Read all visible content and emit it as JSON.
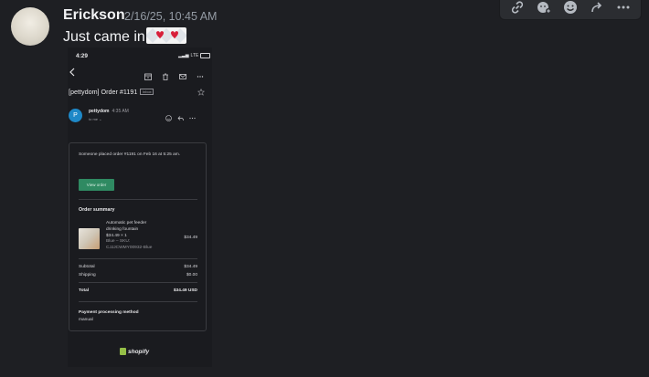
{
  "message": {
    "username": "Erickson",
    "timestamp": "2/16/25, 10:45 AM",
    "text": "Just came in"
  },
  "toolbar": {
    "icons": [
      "link-icon",
      "reaction-icon",
      "emoji-icon",
      "forward-icon",
      "more-icon"
    ]
  },
  "screenshot": {
    "status_time": "4:29",
    "status_network": "LTE",
    "subject": "[pettydom] Order #1191",
    "folder_tag": "Inbox",
    "sender_initial": "P",
    "sender_name": "pettydom",
    "sender_time": "4:35 AM",
    "recipient": "to me",
    "placed_text": "Someone placed order #1191 on Feb 16 at 5:25 am.",
    "view_order_label": "View order",
    "order_summary_title": "Order summary",
    "product_name": "Automatic pet feeder drinking fountain",
    "product_qty": "$34.49 × 1",
    "product_meta": "Blue – SKU: CJJJCWMY00932-Blue",
    "product_price": "$34.49",
    "subtotal_label": "Subtotal",
    "subtotal_value": "$34.49",
    "shipping_label": "Shipping",
    "shipping_value": "$0.00",
    "total_label": "Total",
    "total_value": "$34.49 USD",
    "payment_title": "Payment processing method",
    "payment_value": "manual",
    "shopify_label": "shopify"
  }
}
